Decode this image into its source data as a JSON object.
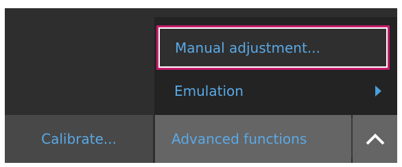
{
  "menu": {
    "items": [
      {
        "label": "Manual adjustment...",
        "selected": true
      },
      {
        "label": "Emulation",
        "has_submenu": true
      }
    ]
  },
  "toolbar": {
    "calibrate_label": "Calibrate...",
    "advanced_label": "Advanced functions",
    "expand_icon": "chevron-up-icon"
  },
  "colors": {
    "text_accent": "#5aa9e6",
    "selection_border": "#c81c6e",
    "panel_bg": "#2e2e2e",
    "button_bg": "#656565"
  }
}
